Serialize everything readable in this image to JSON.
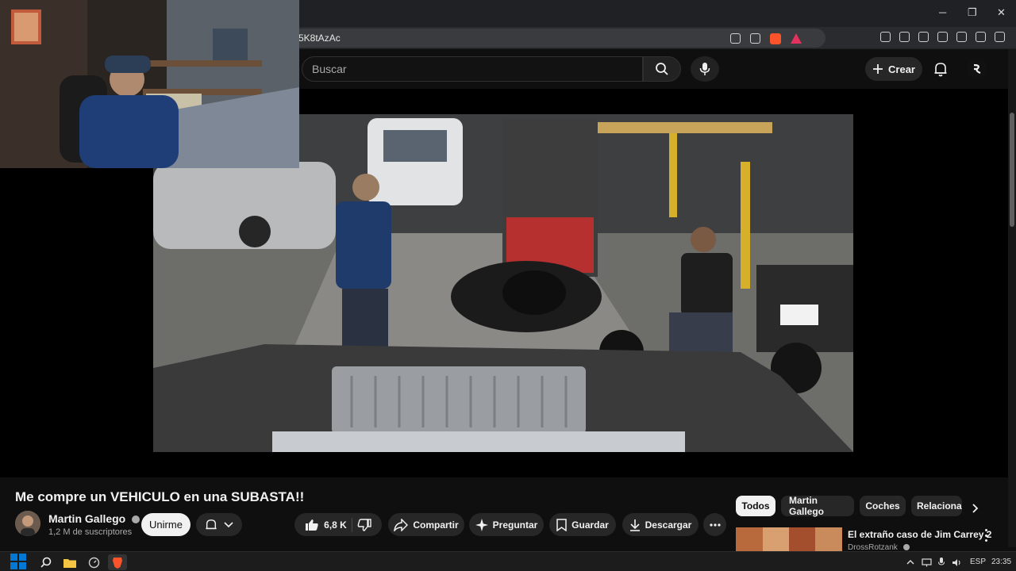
{
  "browser": {
    "url": "5K8tAzAc",
    "window_controls": {
      "minimize": "─",
      "maximize": "❐",
      "close": "✕"
    }
  },
  "header": {
    "search_placeholder": "Buscar",
    "create_label": "Crear"
  },
  "video": {
    "title": "Me compre un VEHICULO en una SUBASTA!!",
    "channel_name": "Martin Gallego",
    "subscribers": "1,2 M de suscriptores",
    "join_label": "Unirme",
    "likes": "6,8 K",
    "share_label": "Compartir",
    "ask_label": "Preguntar",
    "save_label": "Guardar",
    "download_label": "Descargar"
  },
  "sidebar": {
    "chips": [
      {
        "label": "Todos",
        "active": true
      },
      {
        "label": "Martin Gallego",
        "active": false
      },
      {
        "label": "Coches",
        "active": false
      },
      {
        "label": "Relaciona",
        "active": false
      }
    ],
    "recommendation": {
      "title": "El extraño caso de Jim Carrey 2",
      "channel": "DrossRotzank"
    }
  },
  "taskbar": {
    "language": "ESP",
    "time": "23:35"
  },
  "colors": {
    "background": "#0f0f0f",
    "pill": "#272727",
    "brave": "#fb542b",
    "windows_blue": "#0078d4"
  }
}
